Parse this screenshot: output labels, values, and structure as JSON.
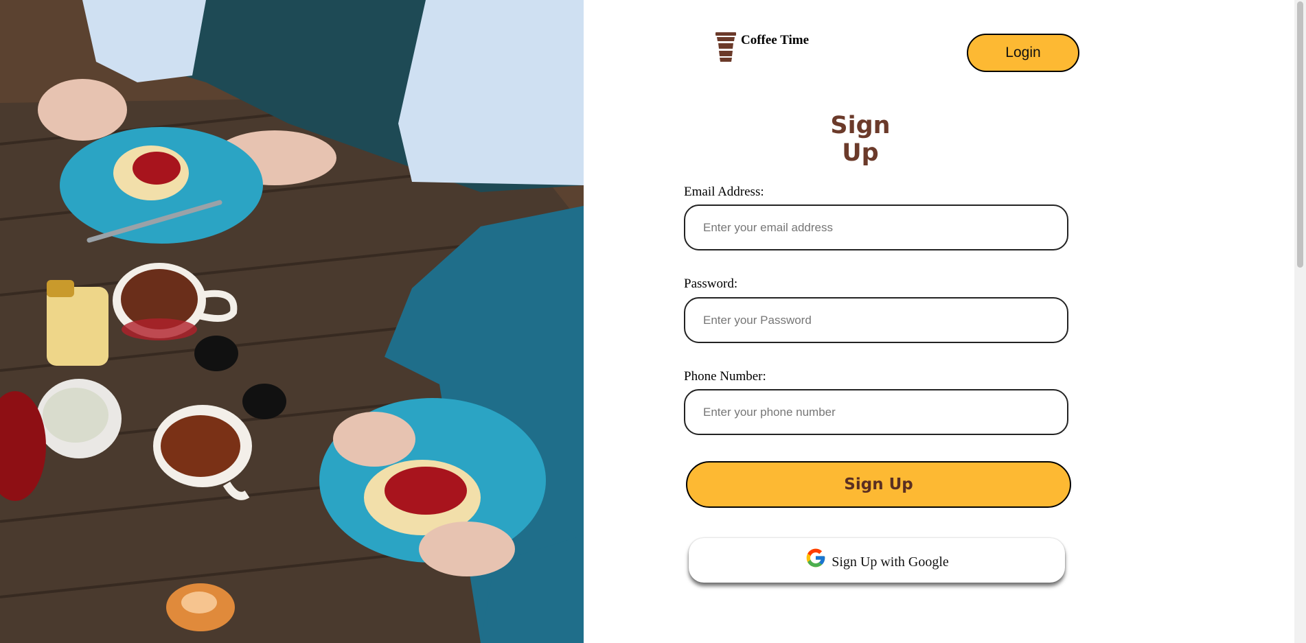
{
  "brand": {
    "name": "Coffee Time",
    "icon": "coffee-cup-icon"
  },
  "header": {
    "login_label": "Login"
  },
  "form": {
    "title": "Sign Up",
    "email": {
      "label": "Email Address:",
      "placeholder": "Enter your email address",
      "value": ""
    },
    "password": {
      "label": "Password:",
      "placeholder": "Enter your Password",
      "value": ""
    },
    "phone": {
      "label": "Phone Number:",
      "placeholder": "Enter your phone number",
      "value": ""
    },
    "submit_label": "Sign Up",
    "google_label": "Sign Up with Google",
    "google_icon": "google-g-icon"
  },
  "colors": {
    "accent": "#fdb933",
    "title": "#6b3a2a",
    "button_text": "#5a2f22",
    "brand_icon": "#6b3a2a"
  }
}
